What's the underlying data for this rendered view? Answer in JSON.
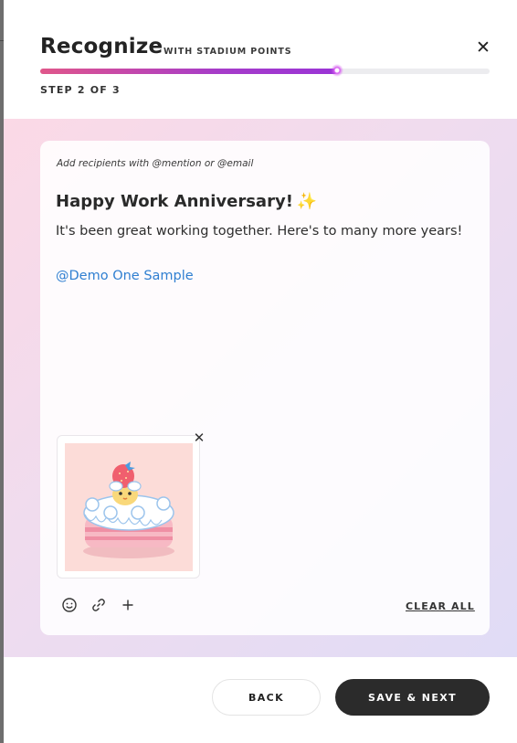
{
  "header": {
    "title": "Recognize",
    "subtitle": "WITH STADIUM POINTS",
    "step_label": "STEP 2 OF 3",
    "progress_fraction": 0.66
  },
  "composer": {
    "hint": "Add recipients with @mention or @email",
    "message_title": "Happy Work Anniversary!",
    "title_emoji": "✨",
    "message_body": "It's been great working together. Here's to many more years!",
    "mention": "@Demo One Sample",
    "gif": {
      "description_icon": "strawberry-cake-gif"
    },
    "toolbar": {
      "emoji_icon": "smiley-icon",
      "link_icon": "link-icon",
      "add_icon": "plus-icon",
      "clear_all_label": "CLEAR ALL"
    }
  },
  "footer": {
    "back_label": "BACK",
    "next_label": "SAVE & NEXT"
  },
  "colors": {
    "accent_pink": "#e0578a",
    "accent_purple": "#9a34d6",
    "mention_blue": "#2f7fd1",
    "primary_button": "#2b2b2b"
  }
}
